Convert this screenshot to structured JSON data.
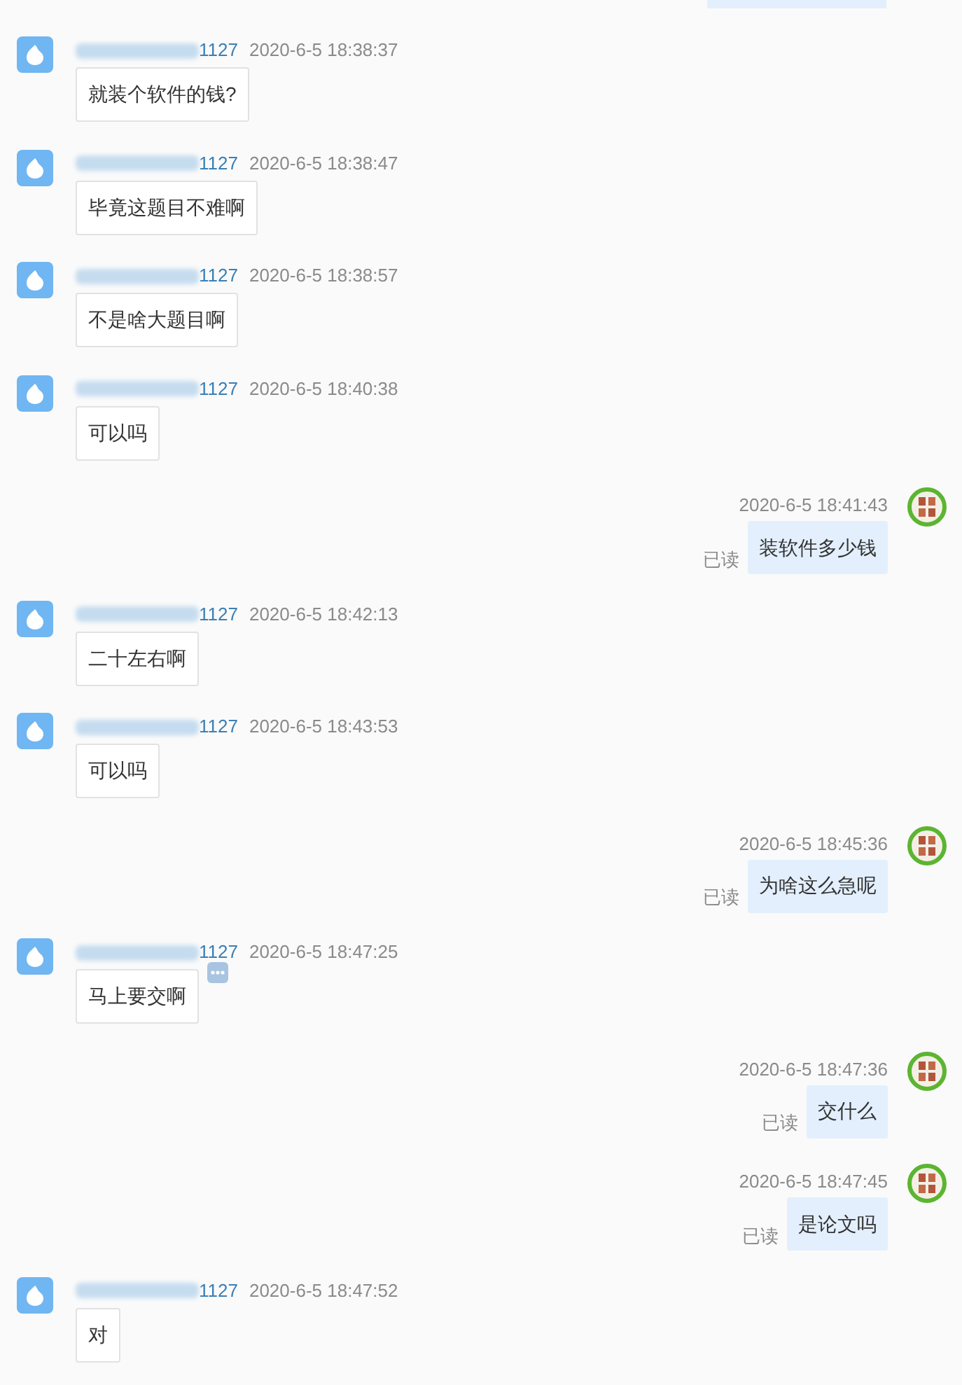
{
  "messages": [
    {
      "kind": "incoming",
      "sender_suffix": "1127",
      "time": "2020-6-5 18:38:37",
      "text": "就装个软件的钱?",
      "more": false
    },
    {
      "kind": "incoming",
      "sender_suffix": "1127",
      "time": "2020-6-5 18:38:47",
      "text": "毕竟这题目不难啊",
      "more": false
    },
    {
      "kind": "incoming",
      "sender_suffix": "1127",
      "time": "2020-6-5 18:38:57",
      "text": "不是啥大题目啊",
      "more": false
    },
    {
      "kind": "incoming",
      "sender_suffix": "1127",
      "time": "2020-6-5 18:40:38",
      "text": "可以吗",
      "more": false
    },
    {
      "kind": "outgoing",
      "time": "2020-6-5 18:41:43",
      "text": "装软件多少钱",
      "status": "已读"
    },
    {
      "kind": "incoming",
      "sender_suffix": "1127",
      "time": "2020-6-5 18:42:13",
      "text": "二十左右啊",
      "more": false
    },
    {
      "kind": "incoming",
      "sender_suffix": "1127",
      "time": "2020-6-5 18:43:53",
      "text": "可以吗",
      "more": false
    },
    {
      "kind": "outgoing",
      "time": "2020-6-5 18:45:36",
      "text": "为啥这么急呢",
      "status": "已读"
    },
    {
      "kind": "incoming",
      "sender_suffix": "1127",
      "time": "2020-6-5 18:47:25",
      "text": "马上要交啊",
      "more": true
    },
    {
      "kind": "outgoing",
      "time": "2020-6-5 18:47:36",
      "text": "交什么",
      "status": "已读"
    },
    {
      "kind": "outgoing",
      "time": "2020-6-5 18:47:45",
      "text": "是论文吗",
      "status": "已读"
    },
    {
      "kind": "incoming",
      "sender_suffix": "1127",
      "time": "2020-6-5 18:47:52",
      "text": "对",
      "more": false
    }
  ]
}
